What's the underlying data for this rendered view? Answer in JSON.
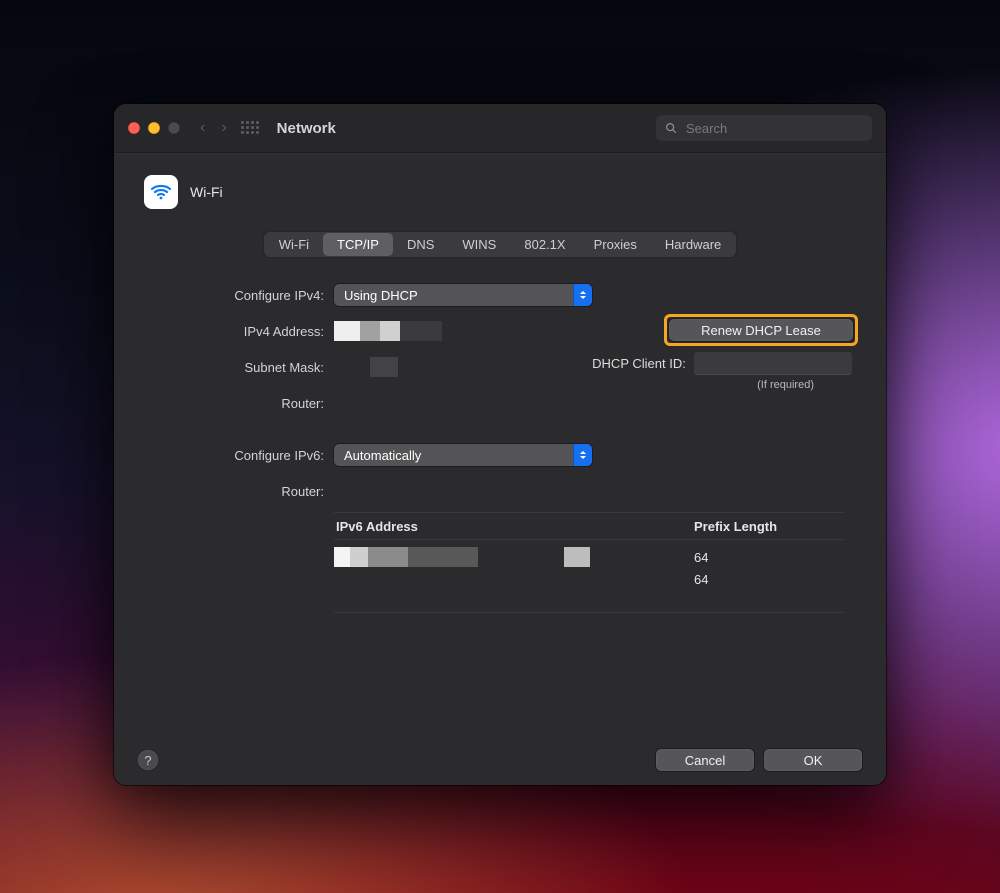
{
  "window": {
    "title": "Network",
    "search_placeholder": "Search"
  },
  "service": {
    "name": "Wi-Fi"
  },
  "tabs": [
    {
      "label": "Wi-Fi"
    },
    {
      "label": "TCP/IP",
      "active": true
    },
    {
      "label": "DNS"
    },
    {
      "label": "WINS"
    },
    {
      "label": "802.1X"
    },
    {
      "label": "Proxies"
    },
    {
      "label": "Hardware"
    }
  ],
  "labels": {
    "configure_ipv4": "Configure IPv4:",
    "ipv4_address": "IPv4 Address:",
    "subnet_mask": "Subnet Mask:",
    "router_v4": "Router:",
    "configure_ipv6": "Configure IPv6:",
    "router_v6": "Router:",
    "dhcp_client_id": "DHCP Client ID:",
    "if_required": "(If required)"
  },
  "values": {
    "configure_ipv4": "Using DHCP",
    "configure_ipv6": "Automatically"
  },
  "buttons": {
    "renew": "Renew DHCP Lease",
    "cancel": "Cancel",
    "ok": "OK"
  },
  "ipv6_table": {
    "header_address": "IPv6 Address",
    "header_prefix": "Prefix Length",
    "rows": [
      {
        "prefix_length": "64"
      },
      {
        "prefix_length": "64"
      }
    ]
  }
}
